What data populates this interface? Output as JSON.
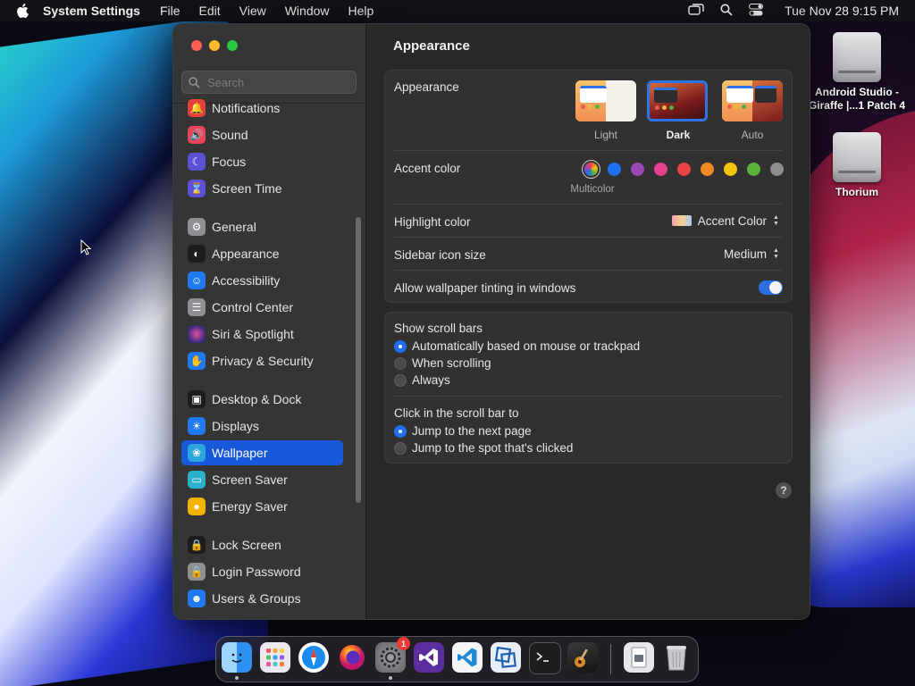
{
  "menubar": {
    "app_name": "System Settings",
    "menus": [
      "File",
      "Edit",
      "View",
      "Window",
      "Help"
    ],
    "clock": "Tue Nov 28  9:15 PM"
  },
  "desktop": {
    "items": [
      {
        "label": "Android Studio - Giraffe |...1 Patch 4",
        "icon": "drive-icon"
      },
      {
        "label": "Thorium",
        "icon": "drive-icon"
      }
    ]
  },
  "sidebar": {
    "search_placeholder": "Search",
    "items": [
      {
        "label": "Notifications",
        "icon": "bell-icon",
        "color": "#e5413c"
      },
      {
        "label": "Sound",
        "icon": "speaker-icon",
        "color": "#e8455d"
      },
      {
        "label": "Focus",
        "icon": "moon-icon",
        "color": "#5b50d6"
      },
      {
        "label": "Screen Time",
        "icon": "hourglass-icon",
        "color": "#5b50d6"
      },
      {
        "label": "General",
        "icon": "gear-icon",
        "color": "#8e8e93"
      },
      {
        "label": "Appearance",
        "icon": "appearance-icon",
        "color": "#1c1c1e"
      },
      {
        "label": "Accessibility",
        "icon": "accessibility-icon",
        "color": "#1f79f2"
      },
      {
        "label": "Control Center",
        "icon": "toggles-icon",
        "color": "#8e8e93"
      },
      {
        "label": "Siri & Spotlight",
        "icon": "siri-icon",
        "color": "#3a2c7a"
      },
      {
        "label": "Privacy & Security",
        "icon": "hand-icon",
        "color": "#1f79f2"
      },
      {
        "label": "Desktop & Dock",
        "icon": "dock-icon",
        "color": "#1c1c1e"
      },
      {
        "label": "Displays",
        "icon": "sun-icon",
        "color": "#1f79f2"
      },
      {
        "label": "Wallpaper",
        "icon": "flower-icon",
        "color": "#2fa5e0"
      },
      {
        "label": "Screen Saver",
        "icon": "screensaver-icon",
        "color": "#2bb0c9"
      },
      {
        "label": "Energy Saver",
        "icon": "bulb-icon",
        "color": "#f2b300"
      },
      {
        "label": "Lock Screen",
        "icon": "lock-icon",
        "color": "#1c1c1e"
      },
      {
        "label": "Login Password",
        "icon": "lock-icon",
        "color": "#8e8e93"
      },
      {
        "label": "Users & Groups",
        "icon": "users-icon",
        "color": "#1f79f2"
      }
    ],
    "active": "Wallpaper"
  },
  "content": {
    "title": "Appearance",
    "appearance": {
      "label": "Appearance",
      "options": [
        "Light",
        "Dark",
        "Auto"
      ],
      "selected": "Dark"
    },
    "accent": {
      "label": "Accent color",
      "selected_label": "Multicolor",
      "colors": [
        "multicolor",
        "#1f6ff0",
        "#9a47b8",
        "#e6418a",
        "#ea4343",
        "#f08a24",
        "#f5c40d",
        "#5bb33a",
        "#8e8e8e"
      ]
    },
    "highlight": {
      "label": "Highlight color",
      "value": "Accent Color"
    },
    "sidebar_icon_size": {
      "label": "Sidebar icon size",
      "value": "Medium"
    },
    "wallpaper_tinting": {
      "label": "Allow wallpaper tinting in windows",
      "enabled": true
    },
    "scroll_bars": {
      "label": "Show scroll bars",
      "options": [
        "Automatically based on mouse or trackpad",
        "When scrolling",
        "Always"
      ],
      "selected": 0
    },
    "click_scroll": {
      "label": "Click in the scroll bar to",
      "options": [
        "Jump to the next page",
        "Jump to the spot that's clicked"
      ],
      "selected": 0
    },
    "help": "?"
  },
  "dock": {
    "apps": [
      {
        "name": "finder-icon",
        "running": true
      },
      {
        "name": "launchpad-icon",
        "running": false
      },
      {
        "name": "safari-icon",
        "running": false
      },
      {
        "name": "firefox-icon",
        "running": false
      },
      {
        "name": "system-settings-icon",
        "running": true,
        "badge": "1"
      },
      {
        "name": "visual-studio-icon",
        "running": false
      },
      {
        "name": "vscode-icon",
        "running": false
      },
      {
        "name": "virtualbox-icon",
        "running": false
      },
      {
        "name": "terminal-icon",
        "running": false
      },
      {
        "name": "instruments-icon",
        "running": false
      },
      {
        "name": "preview-icon",
        "running": false
      },
      {
        "name": "trash-icon",
        "running": false
      }
    ]
  }
}
